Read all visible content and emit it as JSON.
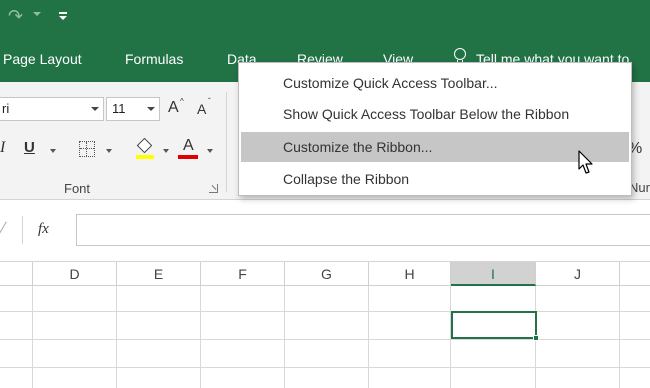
{
  "ribbon_tabs": [
    "Page Layout",
    "Formulas",
    "Data",
    "Review",
    "View"
  ],
  "tell_me": "Tell me what you want to",
  "font": {
    "name": "ri",
    "size": "11",
    "grow_label": "A",
    "shrink_label": "A",
    "italic": "I",
    "underline": "U",
    "font_color_label": "A",
    "group_label": "Font"
  },
  "number_partial": {
    "percent": "%",
    "label": "Nur"
  },
  "formula_bar": {
    "fx": "fx",
    "value": ""
  },
  "columns": [
    "D",
    "E",
    "F",
    "G",
    "H",
    "I",
    "J"
  ],
  "selected_column": "I",
  "context_menu": {
    "items": [
      {
        "label": "Customize Quick Access Toolbar..."
      },
      {
        "label": "Show Quick Access Toolbar Below the Ribbon"
      },
      {
        "label": "Customize the Ribbon..."
      },
      {
        "label": "Collapse the Ribbon"
      }
    ],
    "highlighted_index": 2
  },
  "colors": {
    "accent": "#217346",
    "highlight": "#c6c6c6",
    "fill_color": "#ffff00",
    "font_color": "#e00000"
  },
  "icons": [
    "redo-icon",
    "customize-qat-icon",
    "lightbulb-icon",
    "border-icon",
    "fill-color-icon",
    "font-color-icon",
    "dialog-launcher-icon",
    "mouse-cursor-icon"
  ]
}
